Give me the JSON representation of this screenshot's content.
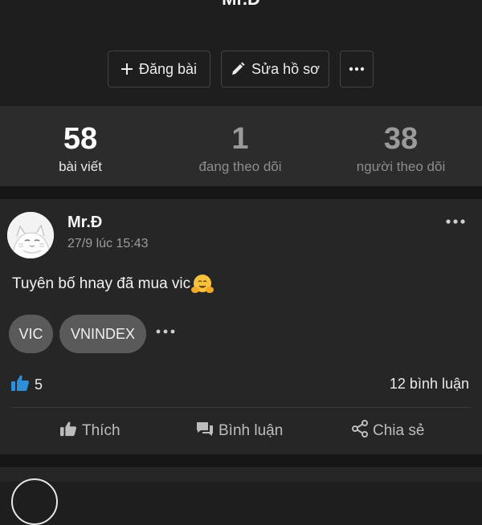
{
  "profile": {
    "name": "Mr.Đ"
  },
  "actions": {
    "post_label": "Đăng bài",
    "edit_label": "Sửa hồ sơ"
  },
  "stats": [
    {
      "value": "58",
      "label": "bài viết"
    },
    {
      "value": "1",
      "label": "đang theo dõi"
    },
    {
      "value": "38",
      "label": "người theo dõi"
    }
  ],
  "post": {
    "author": "Mr.Đ",
    "time": "27/9 lúc 15:43",
    "content": "Tuyên bố hnay đã mua vic",
    "tags": [
      "VIC",
      "VNINDEX"
    ],
    "likes": "5",
    "comments": "12 bình luận",
    "like_label": "Thích",
    "comment_label": "Bình luận",
    "share_label": "Chia sẻ"
  },
  "colors": {
    "background": "#1e1e1e",
    "stats_bg": "#2c2c2c",
    "card_bg": "#262626",
    "tag_bg": "#5a5a5a",
    "like_blue": "#2e8fd8"
  }
}
